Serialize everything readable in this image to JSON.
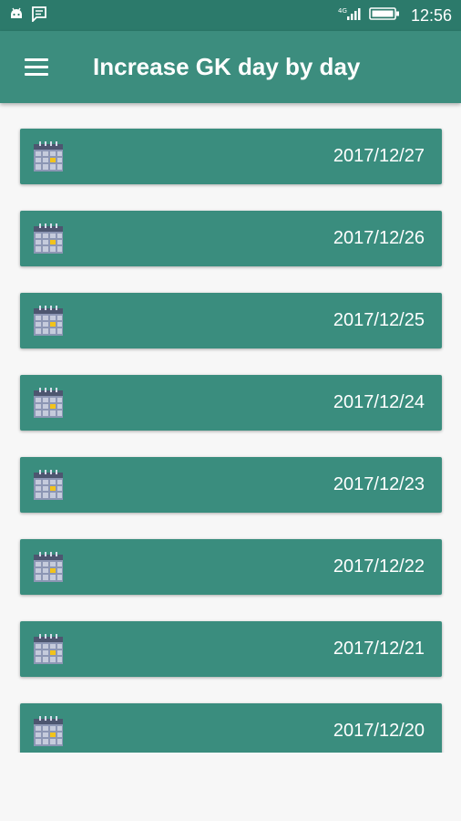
{
  "status_bar": {
    "time": "12:56",
    "left_icons": [
      "android-debug-icon",
      "message-icon"
    ],
    "right_icons": [
      "signal-icon",
      "battery-icon"
    ]
  },
  "app_bar": {
    "title": "Increase GK day by day",
    "menu_icon": "hamburger-menu-icon"
  },
  "colors": {
    "status_bar": "#2c7a6b",
    "app_bar": "#3c8d7e",
    "card": "#3a8d7e",
    "background": "#f7f7f7",
    "text": "#ffffff"
  },
  "list": {
    "item_icon": "calendar-icon",
    "items": [
      {
        "date": "2017/12/27"
      },
      {
        "date": "2017/12/26"
      },
      {
        "date": "2017/12/25"
      },
      {
        "date": "2017/12/24"
      },
      {
        "date": "2017/12/23"
      },
      {
        "date": "2017/12/22"
      },
      {
        "date": "2017/12/21"
      },
      {
        "date": "2017/12/20"
      }
    ]
  }
}
